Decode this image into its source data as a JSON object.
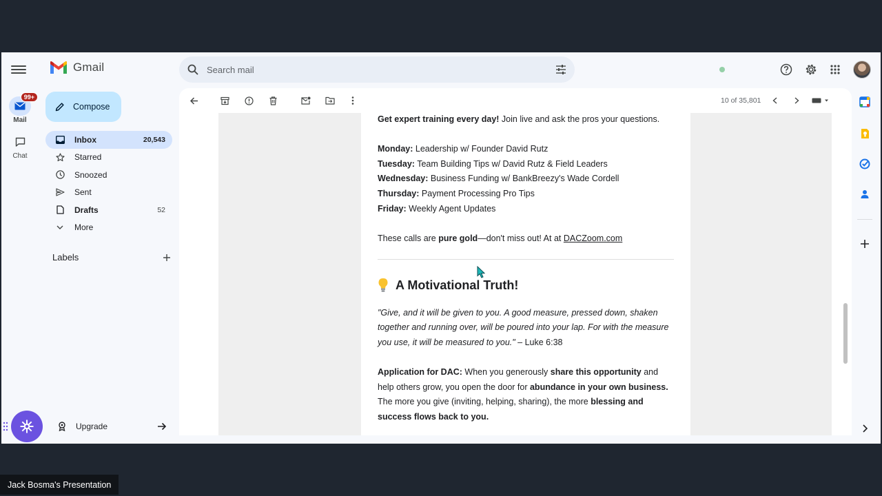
{
  "app": {
    "name": "Gmail"
  },
  "rail": {
    "mail_label": "Mail",
    "mail_badge": "99+",
    "chat_label": "Chat"
  },
  "search": {
    "placeholder": "Search mail"
  },
  "sidebar": {
    "compose_label": "Compose",
    "items": [
      {
        "label": "Inbox",
        "count": "20,543",
        "icon": "inbox-icon",
        "active": true
      },
      {
        "label": "Starred",
        "count": "",
        "icon": "star-icon"
      },
      {
        "label": "Snoozed",
        "count": "",
        "icon": "clock-icon"
      },
      {
        "label": "Sent",
        "count": "",
        "icon": "send-icon"
      },
      {
        "label": "Drafts",
        "count": "52",
        "icon": "draft-icon"
      },
      {
        "label": "More",
        "count": "",
        "icon": "chevron-down-icon"
      }
    ],
    "labels_title": "Labels",
    "upgrade_label": "Upgrade"
  },
  "toolbar": {
    "pager": "10 of 35,801"
  },
  "email": {
    "intro_bold": "Get expert training every day!",
    "intro_rest": " Join live and ask the pros your questions.",
    "schedule": [
      {
        "day": "Monday:",
        "topic": " Leadership w/ Founder David Rutz"
      },
      {
        "day": "Tuesday:",
        "topic": " Team Building Tips w/ David Rutz & Field Leaders"
      },
      {
        "day": "Wednesday:",
        "topic": " Business Funding w/ BankBreezy's Wade Cordell"
      },
      {
        "day": "Thursday:",
        "topic": " Payment Processing Pro Tips"
      },
      {
        "day": "Friday:",
        "topic": " Weekly Agent Updates"
      }
    ],
    "calls_pre": "These calls are ",
    "calls_bold": "pure gold",
    "calls_mid": "—don't miss out!  At at ",
    "calls_link": "DACZoom.com",
    "heading": "A Motivational Truth!",
    "quote": "\"Give, and it will be given to you. A good measure, pressed down, shaken together and running over, will be poured into your lap. For with the measure you use, it will be measured to you.\"",
    "quote_ref": " – Luke 6:38",
    "app_label": "Application for DAC:",
    "app_1": " When you generously ",
    "app_bold_1": "share this opportunity",
    "app_2": " and help others grow, you open the door for ",
    "app_bold_2": "abundance in your own business.",
    "app_3": " The more you give (inviting, helping, sharing), the more ",
    "app_bold_3": "blessing and success flows back to you."
  },
  "presenter": {
    "label": "Jack Bosma's Presentation"
  },
  "colors": {
    "accent": "#c2e7ff",
    "active": "#d3e3fd",
    "badge": "#b3261e",
    "fab": "#6b52e0"
  }
}
